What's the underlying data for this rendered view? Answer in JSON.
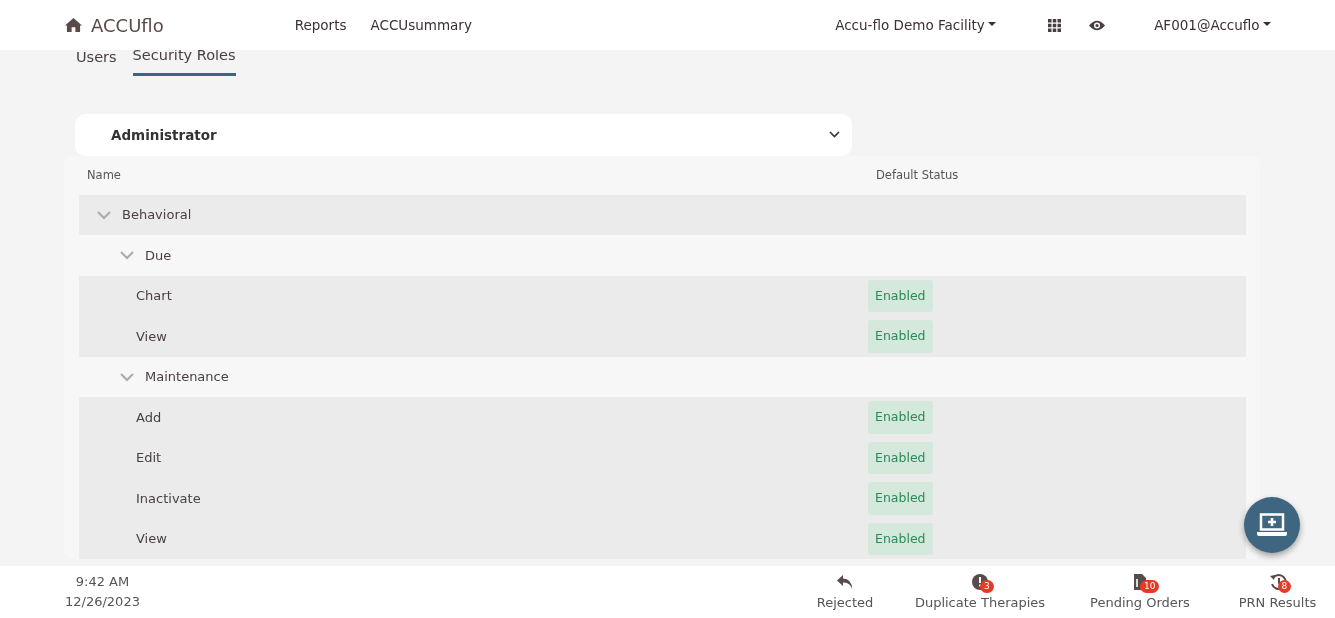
{
  "navbar": {
    "brand": "ACCUflo",
    "links": [
      "Reports",
      "ACCUsummary"
    ],
    "facility": "Accu-flo Demo Facility",
    "user": "AF001@Accuflo"
  },
  "tabs": [
    {
      "label": "Users",
      "selected": false
    },
    {
      "label": "Security Roles",
      "selected": true
    }
  ],
  "role_select": {
    "value": "Administrator"
  },
  "table": {
    "columns": [
      "Name",
      "Default Status"
    ],
    "rows": [
      {
        "kind": "group",
        "name": "Behavioral",
        "expanded": true,
        "children": [
          {
            "kind": "group",
            "name": "Due",
            "expanded": true,
            "children": [
              {
                "kind": "permission",
                "name": "Chart",
                "status": "Enabled"
              },
              {
                "kind": "permission",
                "name": "View",
                "status": "Enabled"
              }
            ]
          },
          {
            "kind": "group",
            "name": "Maintenance",
            "expanded": true,
            "children": [
              {
                "kind": "permission",
                "name": "Add",
                "status": "Enabled"
              },
              {
                "kind": "permission",
                "name": "Edit",
                "status": "Enabled"
              },
              {
                "kind": "permission",
                "name": "Inactivate",
                "status": "Enabled"
              },
              {
                "kind": "permission",
                "name": "View",
                "status": "Enabled"
              }
            ]
          }
        ]
      }
    ]
  },
  "status_bar": {
    "time": "9:42 AM",
    "date": "12/26/2023",
    "items": [
      {
        "kind": "rejected",
        "label": "Rejected"
      },
      {
        "kind": "duplicate",
        "label": "Duplicate Therapies",
        "count": "3"
      },
      {
        "kind": "pending",
        "label": "Pending Orders",
        "count": "10"
      },
      {
        "kind": "prn",
        "label": "PRN Results",
        "count": "8"
      }
    ]
  }
}
